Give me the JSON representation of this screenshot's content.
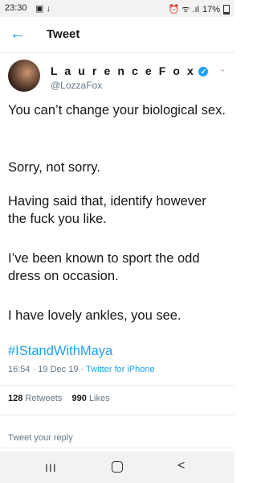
{
  "status": {
    "time": "23:30",
    "left_icons": "▣ ↓",
    "right_icons": "⏰ ᯤ .ıl",
    "battery": "17%"
  },
  "header": {
    "back_icon": "←",
    "title": "Tweet"
  },
  "tweet": {
    "author_name": "L a u r e n c e  F o x",
    "verified_icon": "✓",
    "handle": "@LozzaFox",
    "menu_icon": "⌄",
    "paragraphs": [
      "You can’t change your biological sex.",
      "Sorry, not sorry.",
      "Having said that, identify however the fuck you like.",
      "I’ve been known to sport the odd dress on occasion.",
      "I have lovely ankles, you see."
    ],
    "hashtag": "#IStandWithMaya",
    "timestamp": "16:54 · 19 Dec 19 ·",
    "client": "Twitter for iPhone",
    "retweets_count": "128",
    "retweets_label": "Retweets",
    "likes_count": "990",
    "likes_label": "Likes"
  },
  "reply": {
    "placeholder": "Tweet your reply"
  },
  "navbar": {
    "recent_icon": "III",
    "home_icon": "home-icon",
    "back_icon": "<"
  },
  "colors": {
    "accent": "#1da1f2",
    "text": "#14171a",
    "muted": "#657786"
  }
}
